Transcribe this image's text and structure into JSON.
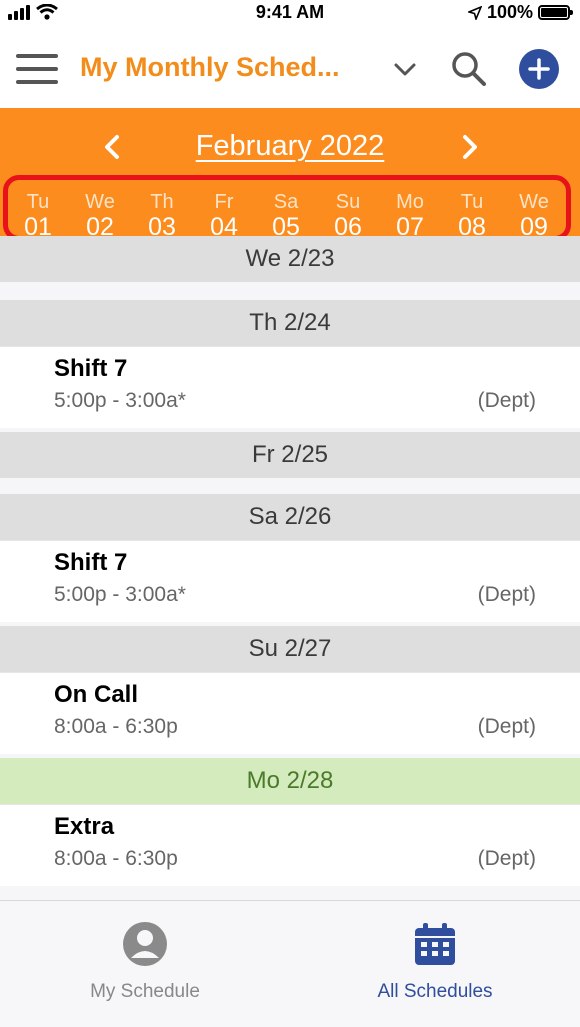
{
  "status_bar": {
    "time": "9:41 AM",
    "battery": "100%",
    "battery_level": 1.0
  },
  "header": {
    "title": "My Monthly Sched...",
    "menu_icon": "hamburger-menu-icon",
    "dropdown_icon": "chevron-down-icon",
    "search_icon": "search-icon",
    "add_icon": "plus-icon"
  },
  "month_nav": {
    "label": "February 2022",
    "prev_icon": "chevron-left-icon",
    "next_icon": "chevron-right-icon"
  },
  "day_strip": [
    {
      "abbr": "Tu",
      "num": "01"
    },
    {
      "abbr": "We",
      "num": "02"
    },
    {
      "abbr": "Th",
      "num": "03"
    },
    {
      "abbr": "Fr",
      "num": "04"
    },
    {
      "abbr": "Sa",
      "num": "05"
    },
    {
      "abbr": "Su",
      "num": "06"
    },
    {
      "abbr": "Mo",
      "num": "07"
    },
    {
      "abbr": "Tu",
      "num": "08"
    },
    {
      "abbr": "We",
      "num": "09"
    }
  ],
  "schedule": {
    "days": [
      {
        "label": "We 2/23",
        "today": false,
        "shifts": []
      },
      {
        "label": "Th 2/24",
        "today": false,
        "shifts": [
          {
            "name": "Shift 7",
            "time": "5:00p - 3:00a*",
            "dept": "(Dept)"
          }
        ]
      },
      {
        "label": "Fr 2/25",
        "today": false,
        "shifts": []
      },
      {
        "label": "Sa 2/26",
        "today": false,
        "shifts": [
          {
            "name": "Shift 7",
            "time": "5:00p - 3:00a*",
            "dept": "(Dept)"
          }
        ]
      },
      {
        "label": "Su 2/27",
        "today": false,
        "shifts": [
          {
            "name": "On Call",
            "time": "8:00a - 6:30p",
            "dept": "(Dept)"
          }
        ]
      },
      {
        "label": "Mo 2/28",
        "today": true,
        "shifts": [
          {
            "name": "Extra",
            "time": "8:00a - 6:30p",
            "dept": "(Dept)"
          }
        ]
      }
    ]
  },
  "tabs": [
    {
      "label": "My Schedule",
      "icon": "user-avatar-icon",
      "active": false
    },
    {
      "label": "All Schedules",
      "icon": "calendar-icon",
      "active": true
    }
  ],
  "colors": {
    "accent_orange": "#fb8c1d",
    "title_orange": "#f28c1b",
    "highlight_red": "#e8121b",
    "primary_blue": "#2f4e9e",
    "today_green": "#d4ebbd"
  }
}
